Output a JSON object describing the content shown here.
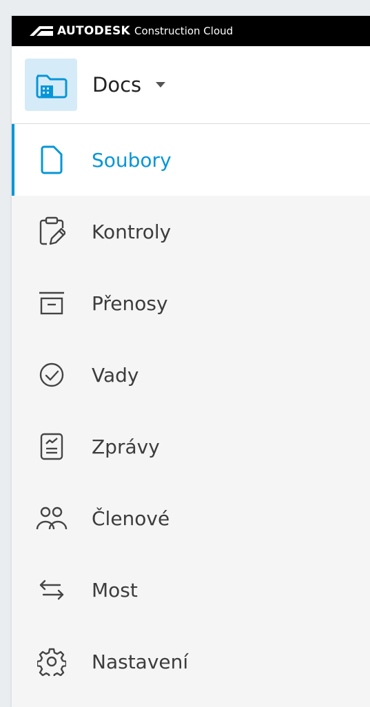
{
  "brand": {
    "main": "AUTODESK",
    "sub": "Construction Cloud"
  },
  "app_switcher": {
    "label": "Docs",
    "icon": "folder-building-icon"
  },
  "nav": [
    {
      "id": "files",
      "label": "Soubory",
      "icon": "file-icon",
      "active": true
    },
    {
      "id": "reviews",
      "label": "Kontroly",
      "icon": "clipboard-pencil-icon",
      "active": false
    },
    {
      "id": "transmittals",
      "label": "Přenosy",
      "icon": "archive-box-icon",
      "active": false
    },
    {
      "id": "issues",
      "label": "Vady",
      "icon": "check-circle-icon",
      "active": false
    },
    {
      "id": "reports",
      "label": "Zprávy",
      "icon": "report-chart-icon",
      "active": false
    },
    {
      "id": "members",
      "label": "Členové",
      "icon": "people-icon",
      "active": false
    },
    {
      "id": "bridge",
      "label": "Most",
      "icon": "swap-arrows-icon",
      "active": false
    },
    {
      "id": "settings",
      "label": "Nastavení",
      "icon": "gear-icon",
      "active": false
    }
  ],
  "colors": {
    "accent": "#0696d7",
    "brandbar": "#000000",
    "app_icon_bg": "#d6ebf8"
  }
}
